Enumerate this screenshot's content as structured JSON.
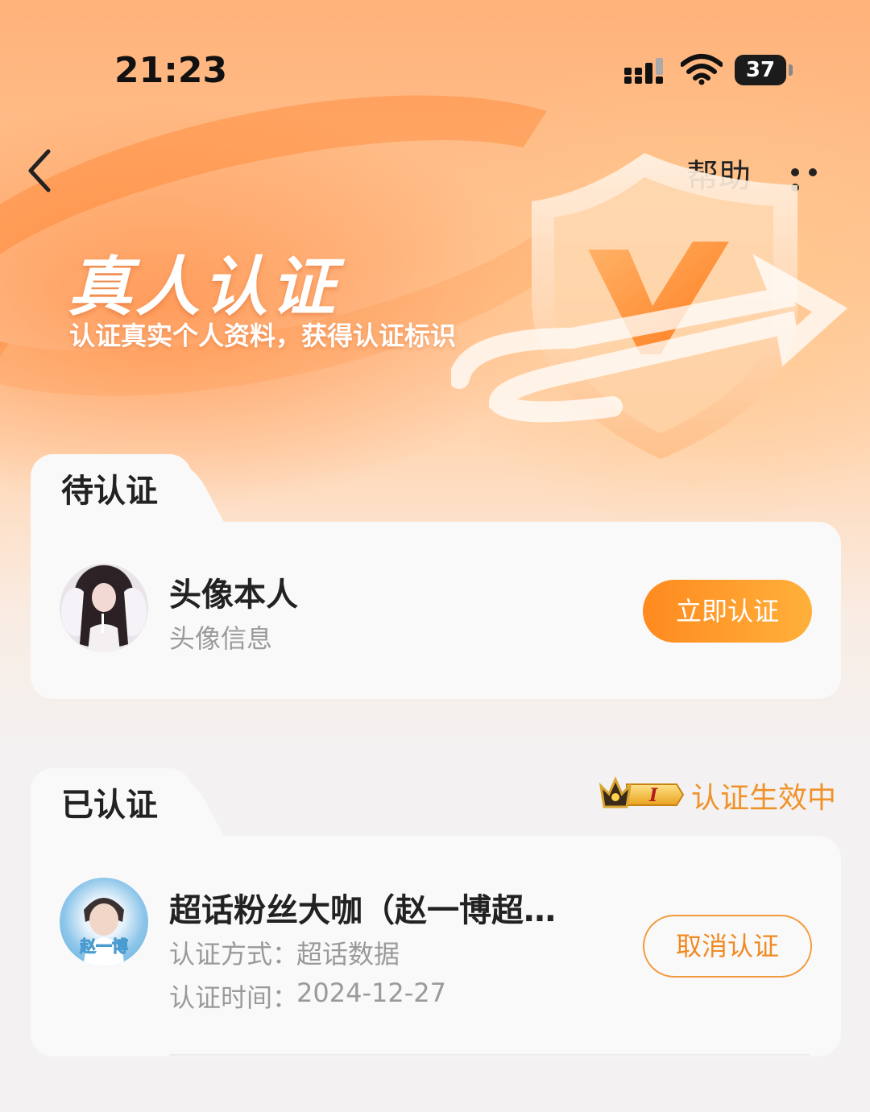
{
  "status_bar": {
    "time": "21:23",
    "battery": "37"
  },
  "nav": {
    "help_label": "帮助"
  },
  "hero": {
    "title": "真人认证",
    "subtitle": "认证真实个人资料，获得认证标识"
  },
  "pending": {
    "tab_label": "待认证",
    "item": {
      "title": "头像本人",
      "subtitle": "头像信息",
      "button_label": "立即认证"
    }
  },
  "verified": {
    "tab_label": "已认证",
    "status_text": "认证生效中",
    "badge_level": "I",
    "item": {
      "title": "超话粉丝大咖（赵一博超…",
      "method_label": "认证方式：",
      "method_value": "超话数据",
      "time_label": "认证时间：",
      "time_value": "2024-12-27",
      "button_label": "取消认证",
      "avatar_caption": "赵一博"
    }
  },
  "colors": {
    "accent": "#ff9a2e",
    "accent_text": "#f0922a",
    "hero_bg": "#ffb27a"
  },
  "icons": {
    "back": "chevron-left-icon",
    "more": "more-dots-icon",
    "signal": "signal-icon",
    "wifi": "wifi-icon",
    "battery": "battery-icon",
    "shield": "shield-check-icon",
    "crown": "crown-icon"
  }
}
